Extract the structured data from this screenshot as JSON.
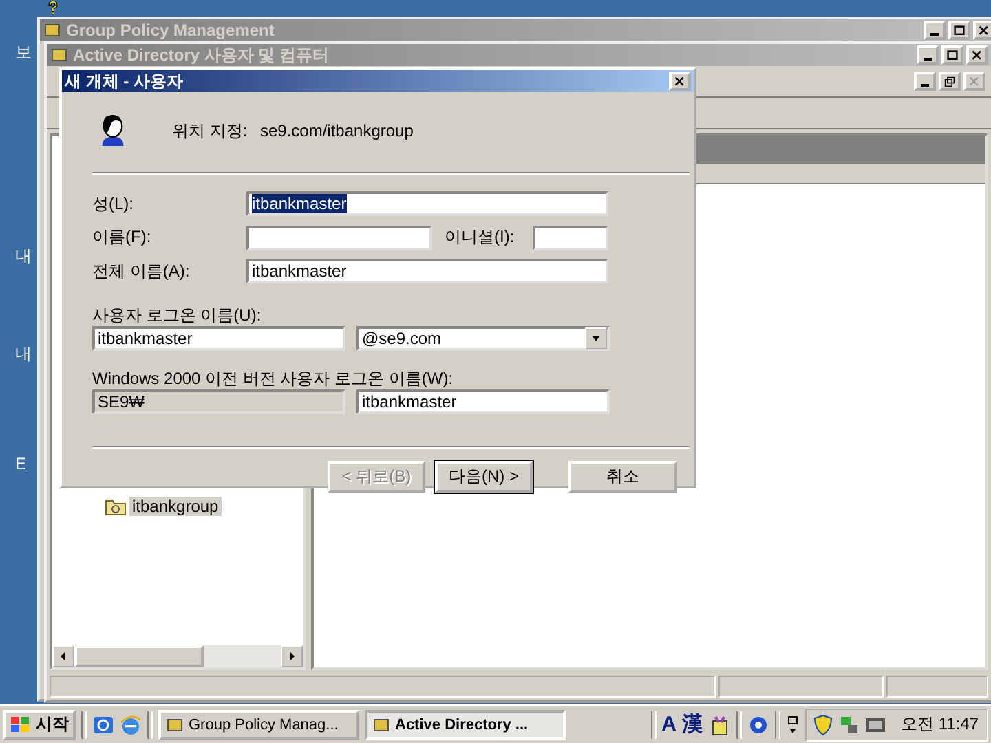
{
  "desktop": {
    "icon_labels": [
      "보",
      "내",
      "내",
      "E"
    ]
  },
  "windows": [
    {
      "title": "Group Policy Management",
      "active": false
    },
    {
      "title": "Active Directory 사용자 및 컴퓨터",
      "active": false
    }
  ],
  "tree": {
    "items": [
      {
        "label": "itbankgroup",
        "selected": true
      }
    ]
  },
  "dialog": {
    "title": "새 개체 - 사용자",
    "active": true,
    "location_label": "위치 지정:",
    "location": "se9.com/itbankgroup",
    "last_name": {
      "label": "성(L):",
      "value": "itbankmaster",
      "text_selected": true
    },
    "first_name": {
      "label": "이름(F):"
    },
    "initials": {
      "label": "이니셜(I):"
    },
    "full_name": {
      "label": "전체 이름(A):",
      "value": "itbankmaster"
    },
    "logon": {
      "label": "사용자 로그온 이름(U):",
      "value": "itbankmaster",
      "domain": "@se9.com"
    },
    "pre2000": {
      "label": "Windows 2000 이전 버전 사용자 로그온 이름(W):",
      "domain": "SE9₩",
      "value": "itbankmaster"
    },
    "buttons": [
      {
        "label": "< 뒤로(B)",
        "disabled": true,
        "default": false
      },
      {
        "label": "다음(N) >",
        "disabled": false,
        "default": true
      },
      {
        "label": "취소",
        "disabled": false,
        "default": false
      }
    ]
  },
  "taskbar": {
    "start": "시작",
    "tasks": [
      {
        "label": "Group Policy Manag...",
        "active": false
      },
      {
        "label": "Active Directory ...",
        "active": true
      }
    ],
    "ime": [
      "A",
      "漢"
    ],
    "clock": "오전 11:47"
  }
}
